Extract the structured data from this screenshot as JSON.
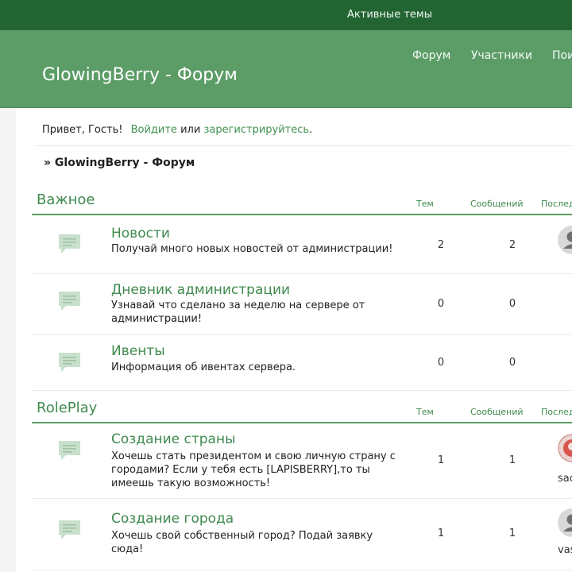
{
  "topbar": {
    "active_topics": "Активные темы"
  },
  "header": {
    "site_title": "GlowingBerry - Форум",
    "nav": [
      {
        "label": "Форум"
      },
      {
        "label": "Участники"
      },
      {
        "label": "Пои"
      }
    ]
  },
  "greeting": {
    "prefix": "Привет, Гость!",
    "login": "Войдите",
    "middle": "или",
    "register": "зарегистрируйтесь",
    "suffix": "."
  },
  "breadcrumb": "» GlowingBerry - Форум",
  "categories": [
    {
      "title": "Важное",
      "columns": {
        "topics": "Тем",
        "posts": "Сообщений",
        "last": "Послед"
      },
      "forums": [
        {
          "name": "Новости",
          "description": "Получай много новых новостей от администрации!",
          "topics": "2",
          "posts": "2",
          "avatar": "default-avatar",
          "last_user": ""
        },
        {
          "name": "Дневник администрации",
          "description": "Узнавай что сделано за неделю на сервере от администрации!",
          "topics": "0",
          "posts": "0",
          "avatar": "",
          "last_user": ""
        },
        {
          "name": "Ивенты",
          "description": "Информация об ивентах сервера.",
          "topics": "0",
          "posts": "0",
          "avatar": "",
          "last_user": ""
        }
      ]
    },
    {
      "title": "RolePlay",
      "columns": {
        "topics": "Тем",
        "posts": "Сообщений",
        "last": "Послед"
      },
      "forums": [
        {
          "name": "Создание страны",
          "description": "Хочешь стать президентом и свою личную страну с городами? Если у тебя есть [LAPISBERRY],то ты имеешь такую возможность!",
          "topics": "1",
          "posts": "1",
          "avatar": "photo-avatar",
          "last_user": "sadDe"
        },
        {
          "name": "Создание города",
          "description": "Хочешь свой собственный город? Подай заявку сюда!",
          "topics": "1",
          "posts": "1",
          "avatar": "default-avatar",
          "last_user": "vasiliy"
        }
      ]
    }
  ],
  "colors": {
    "topbar": "#226533",
    "header": "#5c9c67",
    "accent": "#3f8a4e",
    "link": "#3f9150"
  },
  "icons": {
    "forum": "forum-bubble-icon"
  }
}
